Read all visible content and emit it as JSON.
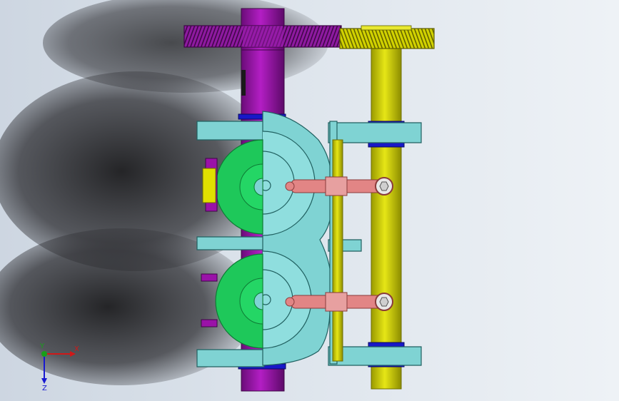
{
  "viewport": {
    "background_top": "#dde4ec",
    "background_bottom": "#eef2f6"
  },
  "colors": {
    "magenta_shaft": "#9a12a8",
    "magenta_dark": "#5a0a63",
    "yellow_shaft": "#d6d600",
    "yellow_dark": "#8a8a00",
    "teal": "#7fd3d3",
    "teal_edge": "#206060",
    "green": "#1ec85a",
    "green_dark": "#0e7a34",
    "salmon": "#e28585",
    "salmon_dark": "#8a3b3b",
    "blue_ring": "#1818c8",
    "x_axis": "#d01818",
    "y_axis": "#18a018",
    "z_axis": "#1818d0"
  },
  "parts": [
    {
      "name": "magenta-gear",
      "icon": "spur-gear"
    },
    {
      "name": "yellow-gear",
      "icon": "spur-gear"
    },
    {
      "name": "magenta-shaft",
      "icon": "shaft"
    },
    {
      "name": "yellow-shaft",
      "icon": "shaft"
    },
    {
      "name": "teal-housing",
      "icon": "housing"
    },
    {
      "name": "green-disc-upper",
      "icon": "disc"
    },
    {
      "name": "green-disc-lower",
      "icon": "disc"
    },
    {
      "name": "connecting-rod-upper",
      "icon": "rod"
    },
    {
      "name": "connecting-rod-lower",
      "icon": "rod"
    }
  ],
  "triad": {
    "x_label": "X",
    "y_label": "Y",
    "z_label": "Z"
  }
}
